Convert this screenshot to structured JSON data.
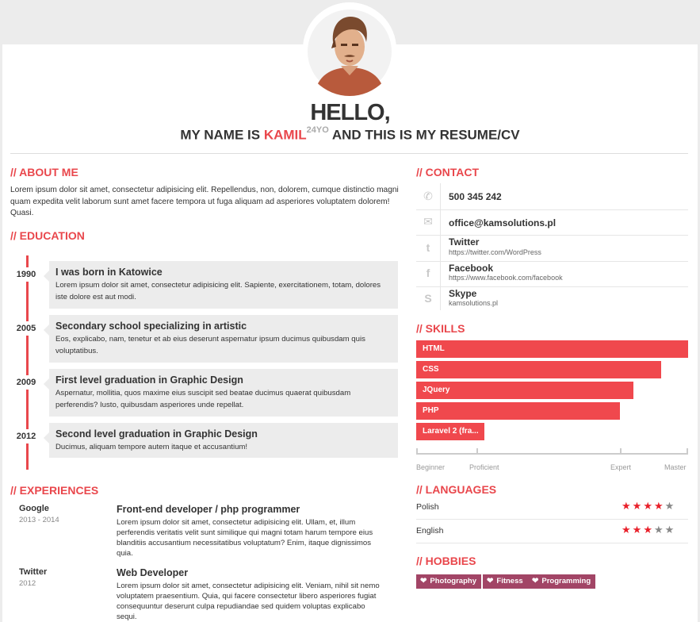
{
  "header": {
    "hello": "HELLO,",
    "intro_prefix": "MY NAME IS ",
    "name": "KAMIL",
    "age": "24YO",
    "intro_suffix": " AND THIS IS MY RESUME/CV"
  },
  "about": {
    "title": "// ABOUT ME",
    "text": "Lorem ipsum dolor sit amet, consectetur adipisicing elit. Repellendus, non, dolorem, cumque distinctio magni quam expedita velit laborum sunt amet facere tempora ut fuga aliquam ad asperiores voluptatem dolorem! Quasi."
  },
  "education": {
    "title": "// EDUCATION",
    "items": [
      {
        "year": "1990",
        "title": "I was born in Katowice",
        "desc": "Lorem ipsum dolor sit amet, consectetur adipisicing elit. Sapiente, exercitationem, totam, dolores iste dolore est aut modi."
      },
      {
        "year": "2005",
        "title": "Secondary school specializing in artistic",
        "desc": "Eos, explicabo, nam, tenetur et ab eius deserunt aspernatur ipsum ducimus quibusdam quis voluptatibus."
      },
      {
        "year": "2009",
        "title": "First level graduation in Graphic Design",
        "desc": "Aspernatur, mollitia, quos maxime eius suscipit sed beatae ducimus quaerat quibusdam perferendis? Iusto, quibusdam asperiores unde repellat."
      },
      {
        "year": "2012",
        "title": "Second level graduation in Graphic Design",
        "desc": "Ducimus, aliquam tempore autem itaque et accusantium!"
      }
    ]
  },
  "experiences": {
    "title": "// EXPERIENCES",
    "items": [
      {
        "company": "Google",
        "dates": "2013 - 2014",
        "role": "Front-end developer / php programmer",
        "desc": "Lorem ipsum dolor sit amet, consectetur adipisicing elit. Ullam, et, illum perferendis veritatis velit sunt similique qui magni totam harum tempore eius blanditiis accusantium necessitatibus voluptatum? Enim, itaque dignissimos quia."
      },
      {
        "company": "Twitter",
        "dates": "2012",
        "role": "Web Developer",
        "desc": "Lorem ipsum dolor sit amet, consectetur adipisicing elit. Veniam, nihil sit nemo voluptatem praesentium. Quia, qui facere consectetur libero asperiores fugiat consequuntur deserunt culpa repudiandae sed quidem voluptas explicabo sequi."
      }
    ]
  },
  "contact": {
    "title": "// CONTACT",
    "items": [
      {
        "icon": "phone-icon",
        "label": "500 345 242",
        "sub": ""
      },
      {
        "icon": "envelope-icon",
        "label": "office@kamsolutions.pl",
        "sub": ""
      },
      {
        "icon": "twitter-icon",
        "label": "Twitter",
        "sub": "https://twitter.com/WordPress"
      },
      {
        "icon": "facebook-icon",
        "label": "Facebook",
        "sub": "https://www.facebook.com/facebook"
      },
      {
        "icon": "skype-icon",
        "label": "Skype",
        "sub": "kamsolutions.pl"
      }
    ]
  },
  "skills": {
    "title": "// SKILLS",
    "items": [
      {
        "name": "HTML",
        "level": 1.0
      },
      {
        "name": "CSS",
        "level": 0.9
      },
      {
        "name": "JQuery",
        "level": 0.8
      },
      {
        "name": "PHP",
        "level": 0.75
      },
      {
        "name": "Laravel 2 (fra...",
        "level": 0.25
      }
    ],
    "scale": [
      "Beginner",
      "Proficient",
      "Expert",
      "Master"
    ],
    "accent": "#f0484d"
  },
  "languages": {
    "title": "// LANGUAGES",
    "items": [
      {
        "name": "Polish",
        "stars": 4,
        "max": 5
      },
      {
        "name": "English",
        "stars": 3,
        "max": 5
      }
    ]
  },
  "hobbies": {
    "title": "// HOBBIES",
    "items": [
      "Photography",
      "Fitness",
      "Programming"
    ],
    "color": "#a24566"
  }
}
